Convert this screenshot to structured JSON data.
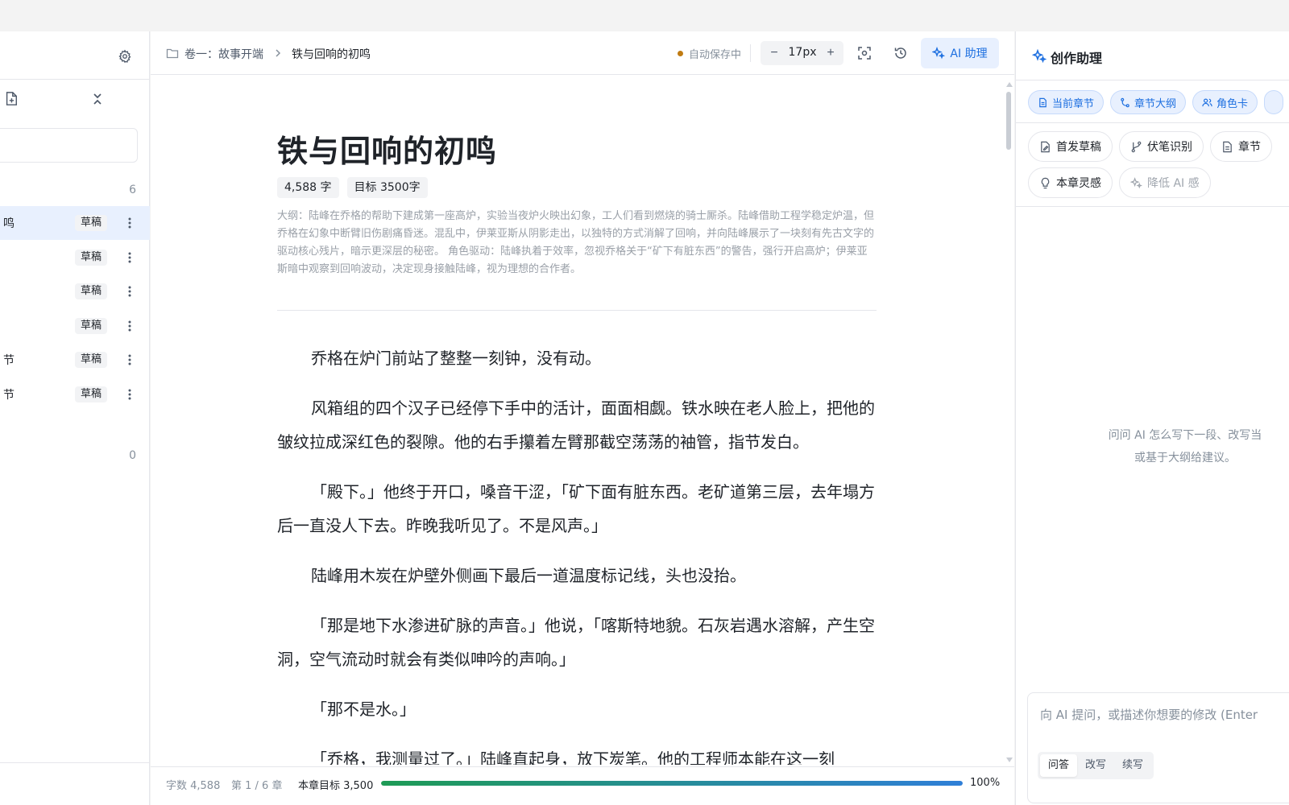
{
  "sidebar": {
    "search_placeholder": "",
    "group1_count": "6",
    "group2_count": "0",
    "chapters": [
      {
        "title": "鸣",
        "status": "草稿"
      },
      {
        "title": "",
        "status": "草稿"
      },
      {
        "title": "",
        "status": "草稿"
      },
      {
        "title": "",
        "status": "草稿"
      },
      {
        "title": "节",
        "status": "草稿"
      },
      {
        "title": "节",
        "status": "草稿"
      }
    ]
  },
  "toolbar": {
    "breadcrumb_volume": "卷一：故事开端",
    "breadcrumb_chapter": "铁与回响的初鸣",
    "autosave": "自动保存中",
    "font_size": "17px",
    "ai_button": "AI 助理",
    "autosave_color": "#c07b12"
  },
  "document": {
    "title": "铁与回响的初鸣",
    "word_count_tag": "4,588 字",
    "target_tag": "目标 3500字",
    "outline": "大纲：陆峰在乔格的帮助下建成第一座高炉，实验当夜炉火映出幻象，工人们看到燃烧的骑士厮杀。陆峰借助工程学稳定炉温，但乔格在幻象中断臂旧伤剧痛昏迷。混乱中，伊莱亚斯从阴影走出，以独特的方式消解了回响，并向陆峰展示了一块刻有先古文字的驱动核心残片，暗示更深层的秘密。 角色驱动：陆峰执着于效率，忽视乔格关于“矿下有脏东西”的警告，强行开启高炉；伊莱亚斯暗中观察到回响波动，决定现身接触陆峰，视为理想的合作者。",
    "paragraphs": [
      "乔格在炉门前站了整整一刻钟，没有动。",
      "风箱组的四个汉子已经停下手中的活计，面面相觑。铁水映在老人脸上，把他的皱纹拉成深红色的裂隙。他的右手攥着左臂那截空荡荡的袖管，指节发白。",
      "「殿下。」他终于开口，嗓音干涩，「矿下面有脏东西。老矿道第三层，去年塌方后一直没人下去。昨晚我听见了。不是风声。」",
      "陆峰用木炭在炉壁外侧画下最后一道温度标记线，头也没抬。",
      "「那是地下水渗进矿脉的声音。」他说，「喀斯特地貌。石灰岩遇水溶解，产生空洞，空气流动时就会有类似呻吟的声响。」",
      "「那不是水。」",
      "「乔格，我测量过了。」陆峰直起身，放下炭笔。他的工程师本能在这一刻"
    ]
  },
  "statusbar": {
    "words": "字数 4,588",
    "chapter_pos": "第 1 / 6 章",
    "target": "本章目标 3,500",
    "progress": 1.0,
    "percent": "100%"
  },
  "panel": {
    "title": "创作助理",
    "context_chips": [
      "当前章节",
      "章节大纲",
      "角色卡"
    ],
    "actions_row1": [
      "首发草稿",
      "伏笔识别",
      "章节"
    ],
    "actions_row2": [
      "本章灵感",
      "降低 AI 感"
    ],
    "empty_line1": "问问 AI 怎么写下一段、改写当",
    "empty_line2": "或基于大纲给建议。",
    "input_placeholder": "向 AI 提问，或描述你想要的修改 (Enter",
    "modes": [
      "问答",
      "改写",
      "续写"
    ],
    "accent_color": "#1d6fe0"
  }
}
